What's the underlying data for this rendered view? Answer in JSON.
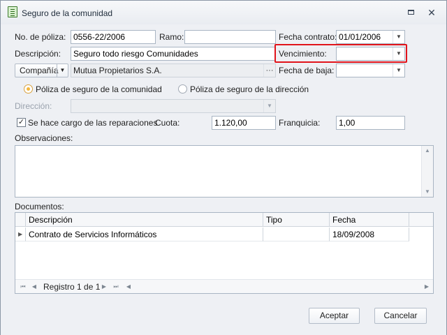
{
  "window": {
    "title": "Seguro de la comunidad"
  },
  "form": {
    "poliza_label": "No. de póliza:",
    "poliza_value": "0556-22/2006",
    "ramo_label": "Ramo:",
    "ramo_value": "",
    "fecha_contrato_label": "Fecha contrato:",
    "fecha_contrato_value": "01/01/2006",
    "descripcion_label": "Descripción:",
    "descripcion_value": "Seguro todo riesgo Comunidades",
    "vencimiento_label": "Vencimiento:",
    "vencimiento_value": "",
    "compania_button": "Compañía",
    "compania_value": "Mutua Propietarios S.A.",
    "ellipsis": "···",
    "fecha_baja_label": "Fecha de baja:",
    "fecha_baja_value": "",
    "radio_comunidad": "Póliza de seguro de la comunidad",
    "radio_direccion": "Póliza de seguro de la dirección",
    "direccion_label": "Dirección:",
    "direccion_value": "",
    "reparaciones_label": "Se hace cargo de las reparaciones",
    "cuota_label": "Cuota:",
    "cuota_value": "1.120,00",
    "franquicia_label": "Franquicia:",
    "franquicia_value": "1,00",
    "observaciones_label": "Observaciones:",
    "documentos_label": "Documentos:"
  },
  "documents": {
    "columns": [
      "Descripción",
      "Tipo",
      "Fecha"
    ],
    "rows": [
      {
        "descripcion": "Contrato de Servicios Informáticos",
        "tipo": "",
        "fecha": "18/09/2008"
      }
    ],
    "navigator": "Registro 1 de 1"
  },
  "footer": {
    "accept": "Aceptar",
    "cancel": "Cancelar"
  }
}
